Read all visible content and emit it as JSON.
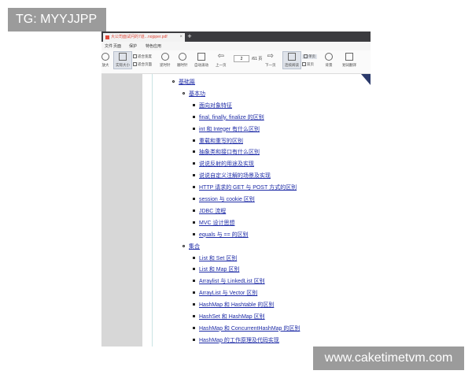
{
  "watermark_top": "TG: MYYJJPP",
  "watermark_bottom": "www.caketimetvm.com",
  "tab": {
    "title": "大公司面试问的7道...nojpper.pdf",
    "close": "×",
    "new_tab": "+"
  },
  "menu": [
    "文件",
    "页面",
    "保护",
    "特色应用"
  ],
  "toolbar": {
    "zoom_in": "放大",
    "actual_size": "实际大小",
    "fit_width": "适合宽度",
    "fit_page": "适合页面",
    "rotate_ccw": "逆时针",
    "rotate_cw": "顺时针",
    "auto_scroll": "自动滚动",
    "prev_page": "上一页",
    "page_current": "2",
    "page_total": "/61 页",
    "next_page": "下一页",
    "read_mode": "连续阅读",
    "single_page": "单页",
    "double_page": "双页",
    "background": "背景",
    "translate": "划词翻译"
  },
  "toc": {
    "level1": "基础篇",
    "sections": [
      {
        "title": "基本功",
        "items": [
          "面向对象特征",
          "final, finally, finalize 的区别",
          "int 和 Integer 有什么区别",
          "重载和重写的区别",
          "抽象类和接口有什么区别",
          "说说反射的用途及实现",
          "说说自定义注解的场景及实现",
          "HTTP 请求的 GET 与 POST 方式的区别",
          "session 与 cookie 区别",
          "JDBC 流程",
          "MVC 设计思想",
          "equals 与 == 的区别"
        ]
      },
      {
        "title": "集合",
        "items": [
          "List 和 Set 区别",
          "List 和 Map 区别",
          "Arraylist 与 LinkedList 区别",
          "ArrayList 与 Vector 区别",
          "HashMap 和 Hashtable 的区别",
          "HashSet 和 HashMap 区别",
          "HashMap 和 ConcurrentHashMap 的区别",
          "HashMap 的工作原理及代码实现"
        ]
      }
    ]
  }
}
